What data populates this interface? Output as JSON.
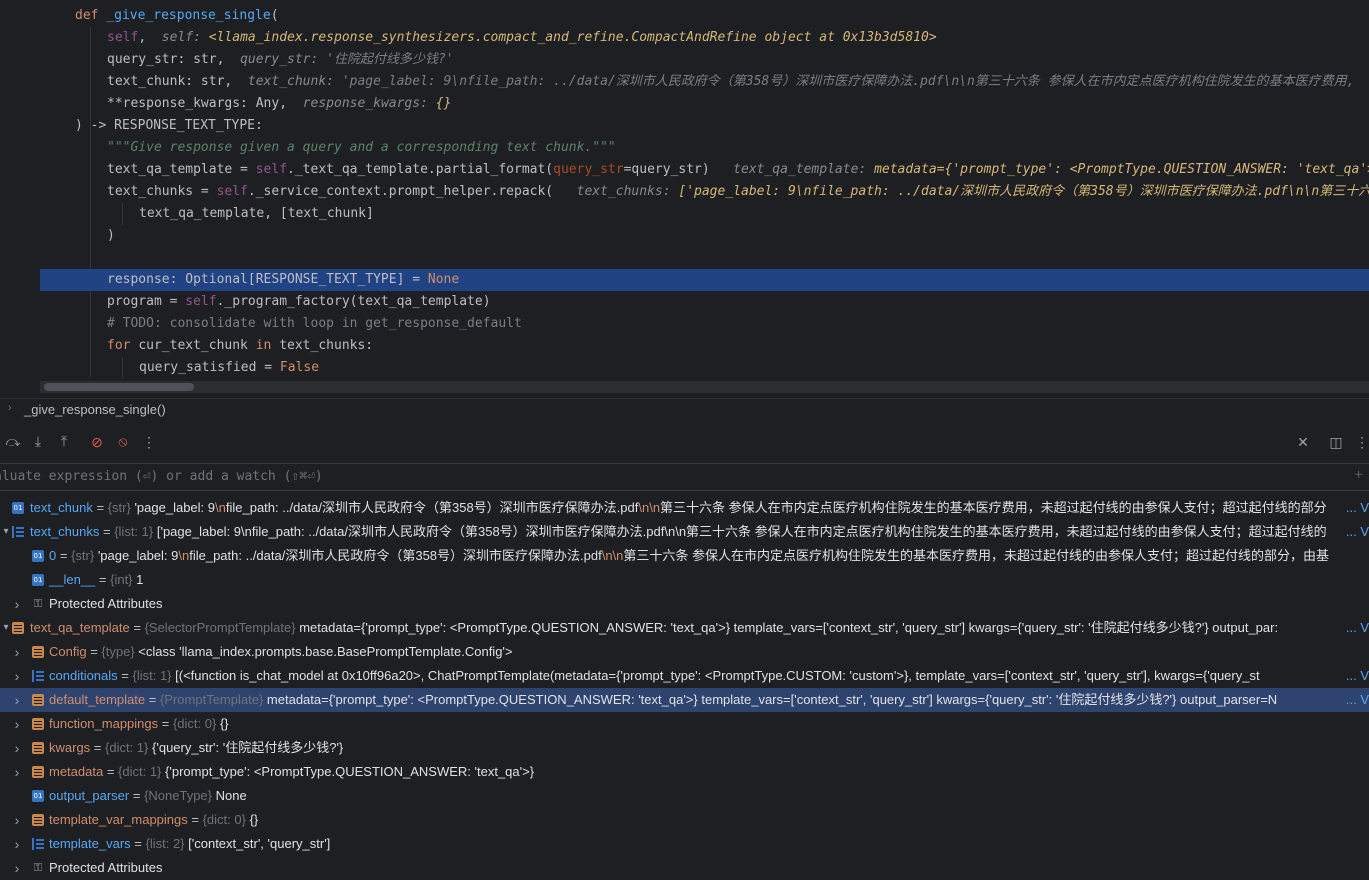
{
  "editor": {
    "lines": [
      {
        "segs": [
          [
            "kw",
            "def "
          ],
          [
            "fn",
            "_give_response_single"
          ],
          [
            "",
            "("
          ]
        ]
      },
      {
        "segs": [
          [
            "self",
            "self"
          ],
          [
            "",
            ",  "
          ],
          [
            "hint",
            "self: "
          ],
          [
            "hintv",
            "<llama_index.response_synthesizers.compact_and_refine.CompactAndRefine object at 0x13b3d5810>"
          ]
        ]
      },
      {
        "segs": [
          [
            "",
            "query_str: "
          ],
          [
            "",
            "str"
          ],
          [
            "",
            ",  "
          ],
          [
            "hint",
            "query_str: "
          ],
          [
            "hints",
            "'住院起付线多少钱?'"
          ]
        ]
      },
      {
        "segs": [
          [
            "",
            "text_chunk: "
          ],
          [
            "",
            "str"
          ],
          [
            "",
            ",  "
          ],
          [
            "hint",
            "text_chunk: "
          ],
          [
            "hints",
            "'page_label: 9\\nfile_path: ../data/深圳市人民政府令（第358号）深圳市医疗保障办法.pdf\\n\\n第三十六条 参保人在市内定点医疗机构住院发生的基本医疗费用,"
          ]
        ]
      },
      {
        "segs": [
          [
            "",
            "**response_kwargs: "
          ],
          [
            "",
            "Any"
          ],
          [
            "",
            ",  "
          ],
          [
            "hint",
            "response_kwargs: "
          ],
          [
            "hintv",
            "{}"
          ]
        ]
      },
      {
        "segs": [
          [
            "",
            ") -> RESPONSE_TEXT_TYPE:"
          ]
        ]
      },
      {
        "segs": [
          [
            "doc",
            "\"\"\"Give response given a query and a corresponding text chunk.\"\"\""
          ]
        ]
      },
      {
        "segs": [
          [
            "",
            "text_qa_template = "
          ],
          [
            "self",
            "self"
          ],
          [
            "",
            "._text_qa_template.partial_format("
          ],
          [
            "param",
            "query_str"
          ],
          [
            "",
            "=query_str)  "
          ],
          [
            "hint",
            " text_qa_template: "
          ],
          [
            "hintv",
            "metadata={'prompt_type': <PromptType.QUESTION_ANSWER: 'text_qa'>}"
          ]
        ]
      },
      {
        "segs": [
          [
            "",
            "text_chunks = "
          ],
          [
            "self",
            "self"
          ],
          [
            "",
            "._service_context.prompt_helper.repack(  "
          ],
          [
            "hint",
            " text_chunks: "
          ],
          [
            "hintv",
            "['page_label: 9\\nfile_path: ../data/深圳市人民政府令（第358号）深圳市医疗保障办法.pdf\\n\\n第三十六条"
          ]
        ]
      },
      {
        "segs": [
          [
            "",
            "text_qa_template, [text_chunk]"
          ]
        ]
      },
      {
        "segs": [
          [
            "",
            ")"
          ]
        ]
      },
      {
        "segs": []
      },
      {
        "segs": [
          [
            "",
            "response: Optional[RESPONSE_TEXT_TYPE] = "
          ],
          [
            "kw",
            "None"
          ]
        ]
      },
      {
        "segs": [
          [
            "",
            "program = "
          ],
          [
            "self",
            "self"
          ],
          [
            "",
            "._program_factory(text_qa_template)"
          ]
        ]
      },
      {
        "segs": [
          [
            "cm",
            "# TODO: consolidate with loop in get_response_default"
          ]
        ]
      },
      {
        "segs": [
          [
            "kw",
            "for "
          ],
          [
            "",
            "cur_text_chunk "
          ],
          [
            "kw",
            "in "
          ],
          [
            "",
            "text_chunks:"
          ]
        ]
      },
      {
        "segs": [
          [
            "",
            "query_satisfied = "
          ],
          [
            "kw",
            "False"
          ]
        ]
      }
    ]
  },
  "breadcrumb": {
    "label": "_give_response_single()"
  },
  "evaluate": {
    "placeholder": "aluate expression (⏎) or add a watch (⇧⌘⏎)"
  },
  "variables": [
    {
      "name": "text_chunk",
      "type": "{str}",
      "value": "'page_label: 9",
      "value2": "file_path: ../data/深圳市人民政府令（第358号）深圳市医疗保障办法.pdf",
      "value3": "第三十六条 参保人在市内定点医疗机构住院发生的基本医疗费用，未超过起付线的由参保人支付；超过起付线的部分",
      "more": "... V"
    },
    {
      "name": "text_chunks",
      "type": "{list: 1}",
      "value": "['page_label: 9\\nfile_path: ../data/深圳市人民政府令（第358号）深圳市医疗保障办法.pdf\\n\\n第三十六条 参保人在市内定点医疗机构住院发生的基本医疗费用，未超过起付线的由参保人支付；超过起付线的",
      "more": "... V"
    },
    {
      "name": "0",
      "type": "{str}",
      "value": "'page_label: 9",
      "value2": "file_path: ../data/深圳市人民政府令（第358号）深圳市医疗保障办法.pdf",
      "value3": "第三十六条 参保人在市内定点医疗机构住院发生的基本医疗费用，未超过起付线的由参保人支付；超过起付线的部分，由基",
      "more": ""
    },
    {
      "name": "__len__",
      "type": "{int}",
      "value": "1",
      "more": ""
    },
    {
      "name": "Protected Attributes",
      "type": "",
      "value": "",
      "more": ""
    },
    {
      "name": "text_qa_template",
      "type": "{SelectorPromptTemplate}",
      "value": "metadata={'prompt_type': <PromptType.QUESTION_ANSWER: 'text_qa'>} template_vars=['context_str', 'query_str'] kwargs={'query_str': '住院起付线多少钱?'} output_par:",
      "more": "... V"
    },
    {
      "name": "Config",
      "type": "{type}",
      "value": "<class 'llama_index.prompts.base.BasePromptTemplate.Config'>",
      "more": ""
    },
    {
      "name": "conditionals",
      "type": "{list: 1}",
      "value": "[(<function is_chat_model at 0x10ff96a20>, ChatPromptTemplate(metadata={'prompt_type': <PromptType.CUSTOM: 'custom'>}, template_vars=['context_str', 'query_str'], kwargs={'query_st",
      "more": "... V"
    },
    {
      "name": "default_template",
      "type": "{PromptTemplate}",
      "value": "metadata={'prompt_type': <PromptType.QUESTION_ANSWER: 'text_qa'>} template_vars=['context_str', 'query_str'] kwargs={'query_str': '住院起付线多少钱?'} output_parser=N",
      "more": "... V"
    },
    {
      "name": "function_mappings",
      "type": "{dict: 0}",
      "value": "{}",
      "more": ""
    },
    {
      "name": "kwargs",
      "type": "{dict: 1}",
      "value": "{'query_str': '住院起付线多少钱?'}",
      "more": ""
    },
    {
      "name": "metadata",
      "type": "{dict: 1}",
      "value": "{'prompt_type': <PromptType.QUESTION_ANSWER: 'text_qa'>}",
      "more": ""
    },
    {
      "name": "output_parser",
      "type": "{NoneType}",
      "value": "None",
      "more": ""
    },
    {
      "name": "template_var_mappings",
      "type": "{dict: 0}",
      "value": "{}",
      "more": ""
    },
    {
      "name": "template_vars",
      "type": "{list: 2}",
      "value": "['context_str', 'query_str']",
      "more": ""
    },
    {
      "name": "Protected Attributes",
      "type": "",
      "value": "",
      "more": ""
    }
  ],
  "icons": {
    "toolbar": [
      "step-over-icon",
      "step-into-icon",
      "step-out-icon",
      "view-breakpoints-icon",
      "mute-breakpoints-icon",
      "more-icon"
    ],
    "right": [
      "close-icon",
      "layout-icon",
      "more-vertical-icon"
    ]
  },
  "colors": {
    "selection": "#214283",
    "tree_selection": "#2e436e",
    "keyword": "#cf8e6d",
    "function": "#56a8f5",
    "self": "#94558d"
  }
}
